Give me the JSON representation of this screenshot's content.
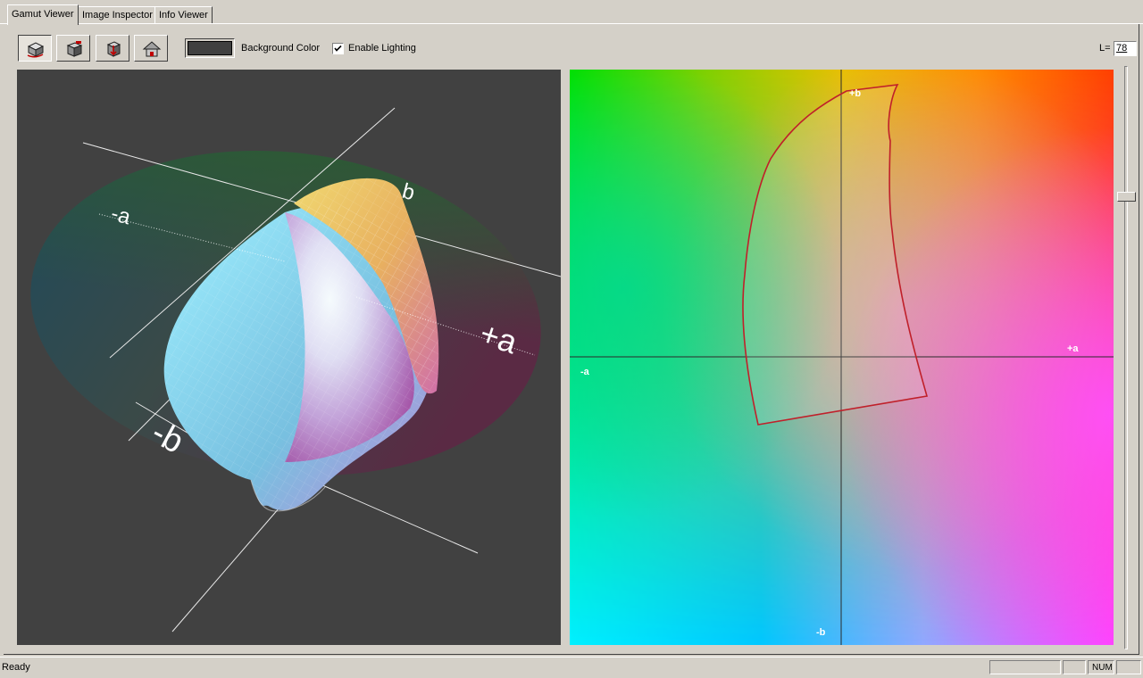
{
  "tabs": [
    {
      "label": "Gamut Viewer",
      "active": true
    },
    {
      "label": "Image Inspector",
      "active": false
    },
    {
      "label": "Info Viewer",
      "active": false
    }
  ],
  "toolbar": {
    "buttons": [
      {
        "icon": "rotate-cube-icon",
        "pressed": true
      },
      {
        "icon": "solid-cube-icon",
        "pressed": false
      },
      {
        "icon": "import-gamut-icon",
        "pressed": false
      },
      {
        "icon": "home-view-icon",
        "pressed": false
      }
    ],
    "background_color_label": "Background Color",
    "background_color": "#404040",
    "enable_lighting_label": "Enable Lighting",
    "enable_lighting_checked": true,
    "lightness_label": "L=",
    "lightness_value": "78"
  },
  "view3d": {
    "axis_labels": {
      "neg_a": "-a",
      "pos_a": "+a",
      "neg_b": "-b",
      "pos_b": "b"
    },
    "background": "#414141"
  },
  "view2d": {
    "axis_labels": {
      "pos_b": "+b",
      "neg_a": "-a",
      "pos_a": "+a",
      "neg_b": "-b"
    },
    "gamut_outline_color": "#c0202a"
  },
  "slider": {
    "lightness": 78
  },
  "status": {
    "text": "Ready",
    "num_indicator": "NUM"
  }
}
